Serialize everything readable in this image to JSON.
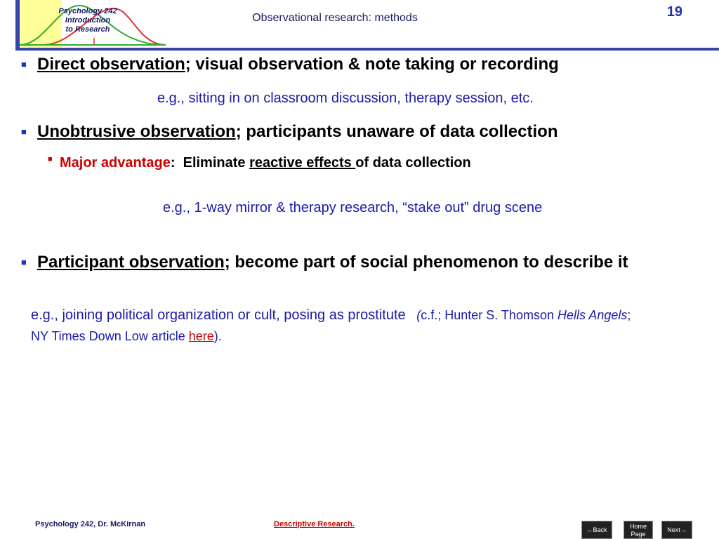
{
  "logo": {
    "line1": "Psychology 242",
    "line2": "Introduction",
    "line3": "to Research"
  },
  "title": "Observational research: methods",
  "page_number": "19",
  "bullets": {
    "b1_term": "Direct observation",
    "b1_rest": "; visual observation & note taking or recording",
    "b1_example": "e.g., sitting in on classroom discussion, therapy session, etc.",
    "b2_term": "Unobtrusive observation",
    "b2_rest": "; participants unaware of data collection",
    "b2_sub_label": "Major advantage",
    "b2_sub_colon": ":  Eliminate ",
    "b2_sub_term": "reactive effects ",
    "b2_sub_rest": "of data collection",
    "b2_example": "e.g., 1-way mirror & therapy research, “stake out” drug scene",
    "b3_term": "Participant observation",
    "b3_rest": "; become part of social phenomenon to describe it",
    "b3_example_main": "e.g., joining political organization or cult, posing as prostitute",
    "b3_paren_open": "(",
    "b3_cf": "c.f.; Hunter S. Thomson ",
    "b3_book": "Hells Angels",
    "b3_after_book": "; NY Times Down Low article ",
    "b3_link": "here",
    "b3_close": ")."
  },
  "footer": {
    "left": "Psychology 242, Dr. McKirnan",
    "center": "Descriptive Research."
  },
  "nav": {
    "back": "←Back",
    "home_line1": "Home",
    "home_line2": "Page",
    "next": "Next→"
  },
  "colors": {
    "accent_blue": "#3344aa",
    "bullet_red": "#cc0000",
    "example_blue": "#1a1aaa"
  },
  "icons": [
    "bell-curve-icon",
    "square-bullet-icon"
  ]
}
